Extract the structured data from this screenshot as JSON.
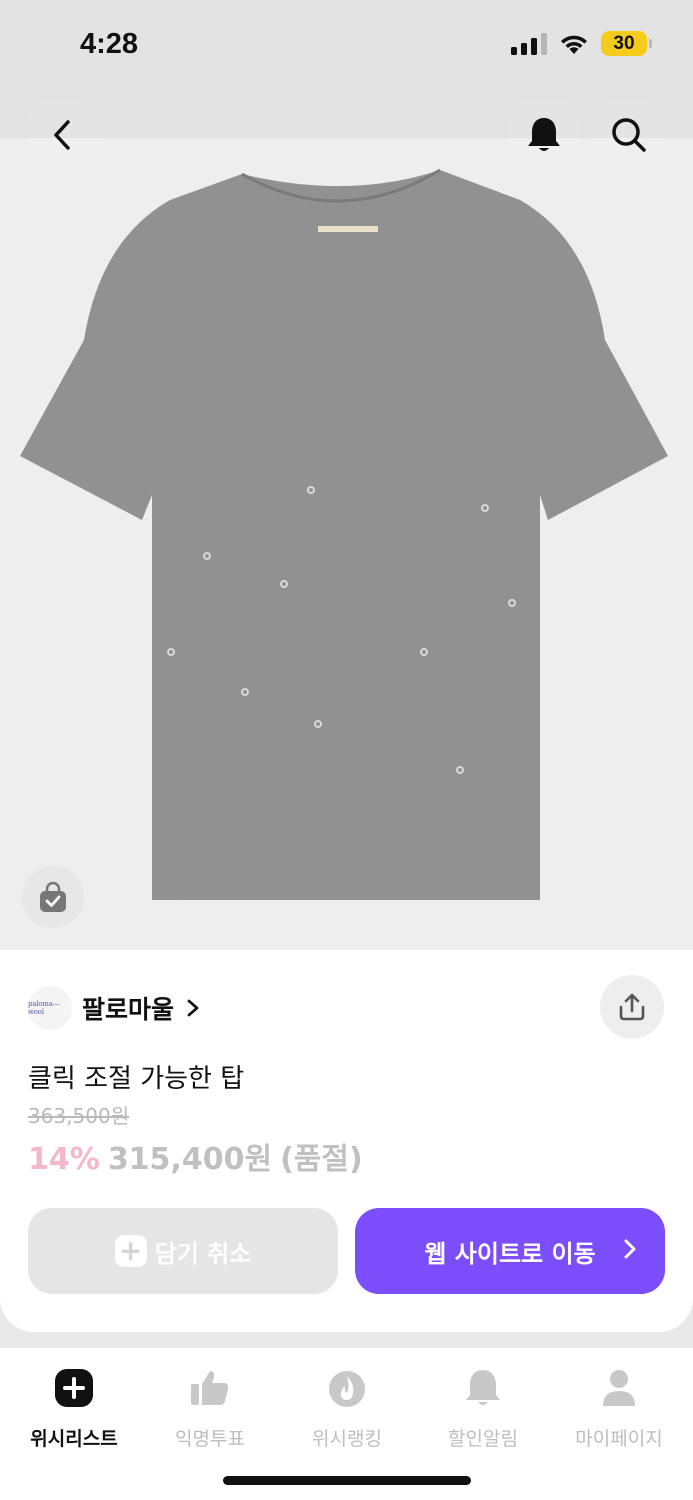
{
  "status_bar": {
    "time": "4:28",
    "battery": "30",
    "signal_icon": "cellular-signal-icon",
    "wifi_icon": "wifi-icon"
  },
  "header": {
    "back_icon": "chevron-left-icon",
    "bell_icon": "bell-icon",
    "search_icon": "search-icon"
  },
  "product_image": {
    "description_icon": "tshirt-image",
    "bag_icon": "shopping-bag-check-icon"
  },
  "brand": {
    "logo_text": "paloma—wool",
    "name": "팔로마울",
    "chevron_icon": "chevron-right-icon"
  },
  "share_icon": "share-icon",
  "product": {
    "title": "클릭 조절 가능한 탑",
    "original_price": "363,500원",
    "discount": "14%",
    "price": "315,400원",
    "stock_status": "(품절)"
  },
  "actions": {
    "cancel_label": "담기 취소",
    "go_label": "웹 사이트로 이동"
  },
  "tabs": [
    {
      "label": "위시리스트",
      "icon": "plus-square-icon",
      "active": true
    },
    {
      "label": "익명투표",
      "icon": "thumbs-up-icon",
      "active": false
    },
    {
      "label": "위시랭킹",
      "icon": "flame-icon",
      "active": false
    },
    {
      "label": "할인알림",
      "icon": "bell-icon",
      "active": false
    },
    {
      "label": "마이페이지",
      "icon": "person-icon",
      "active": false
    }
  ],
  "colors": {
    "accent": "#7c4dfb",
    "discount": "#f6b7c8",
    "muted": "#c0c0c0"
  }
}
